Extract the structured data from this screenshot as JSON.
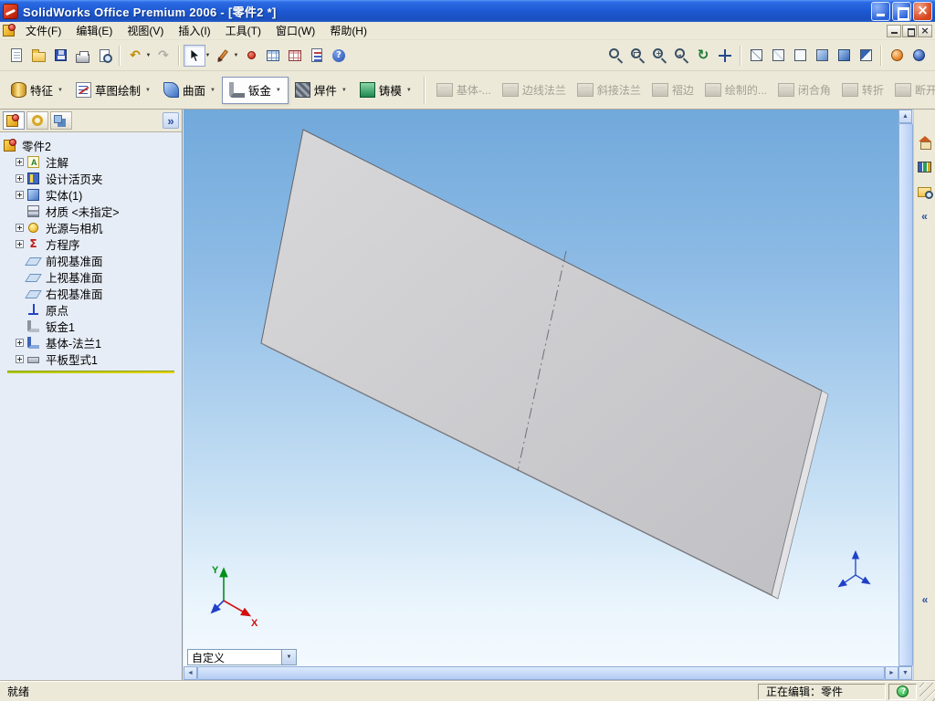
{
  "window": {
    "title": "SolidWorks Office Premium 2006 - [零件2 *]"
  },
  "menu": {
    "items": [
      "文件(F)",
      "编辑(E)",
      "视图(V)",
      "插入(I)",
      "工具(T)",
      "窗口(W)",
      "帮助(H)"
    ]
  },
  "command_manager": {
    "tabs": [
      "特征",
      "草图绘制",
      "曲面",
      "钣金",
      "焊件",
      "铸模"
    ],
    "active_tab": "钣金",
    "tools": [
      "基体-...",
      "边线法兰",
      "斜接法兰",
      "褶边",
      "绘制的...",
      "闭合角",
      "转折",
      "断开边..."
    ]
  },
  "feature_tree": {
    "items": [
      {
        "label": "零件2"
      },
      {
        "label": "注解"
      },
      {
        "label": "设计活页夹"
      },
      {
        "label": "实体(1)"
      },
      {
        "label": "材质 <未指定>"
      },
      {
        "label": "光源与相机"
      },
      {
        "label": "方程序"
      },
      {
        "label": "前视基准面"
      },
      {
        "label": "上视基准面"
      },
      {
        "label": "右视基准面"
      },
      {
        "label": "原点"
      },
      {
        "label": "钣金1"
      },
      {
        "label": "基体-法兰1"
      },
      {
        "label": "平板型式1"
      }
    ]
  },
  "viewport": {
    "view_combo_value": "自定义",
    "triad": {
      "x_label": "X",
      "y_label": "Y"
    }
  },
  "status_bar": {
    "left": "就绪",
    "right": "正在编辑：零件"
  },
  "glyphs": {
    "caret_down": "▼",
    "arrow_up": "▲",
    "arrow_down": "▼",
    "arrow_left": "◄",
    "arrow_right": "►",
    "chevron_expand": "»",
    "chevron_collapse": "«",
    "undo": "↶",
    "redo": "↷",
    "rotate": "↻",
    "sigma": "Σ"
  },
  "colors": {
    "titlebar_blue": "#1C57D0",
    "viewport_top": "#71A9DB",
    "viewport_bottom": "#F4FAFE",
    "part_face": "#CACACC",
    "rollback_yellow": "#E8D400"
  }
}
